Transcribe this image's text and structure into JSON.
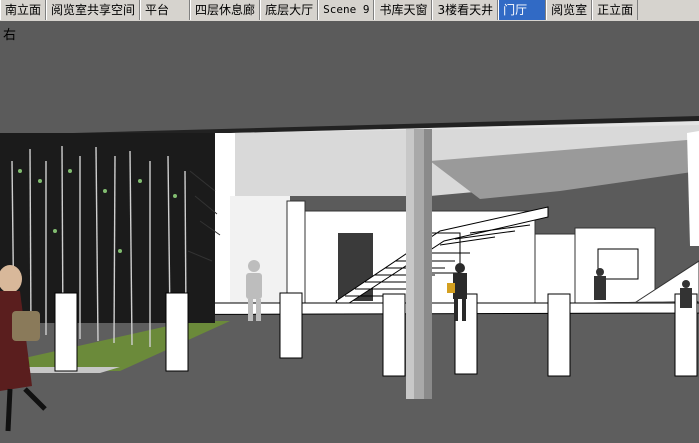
{
  "tabs": [
    {
      "label": "南立面",
      "active": false
    },
    {
      "label": "阅览室共享空间",
      "active": false
    },
    {
      "label": "平台",
      "active": false
    },
    {
      "label": "四层休息廊",
      "active": false
    },
    {
      "label": "底层大厅",
      "active": false
    },
    {
      "label": "Scene 9",
      "active": false
    },
    {
      "label": "书库天窗",
      "active": false
    },
    {
      "label": "3楼看天井",
      "active": false
    },
    {
      "label": "门厅",
      "active": true
    },
    {
      "label": "阅览室",
      "active": false
    },
    {
      "label": "正立面",
      "active": false
    }
  ],
  "viewport": {
    "corner_label": "右"
  },
  "colors": {
    "active_tab": "#316ac5",
    "sky": "#5b5b5b",
    "ceiling": "#dcdcdc",
    "wall": "#ffffff",
    "floor": "#5e5e5e"
  }
}
